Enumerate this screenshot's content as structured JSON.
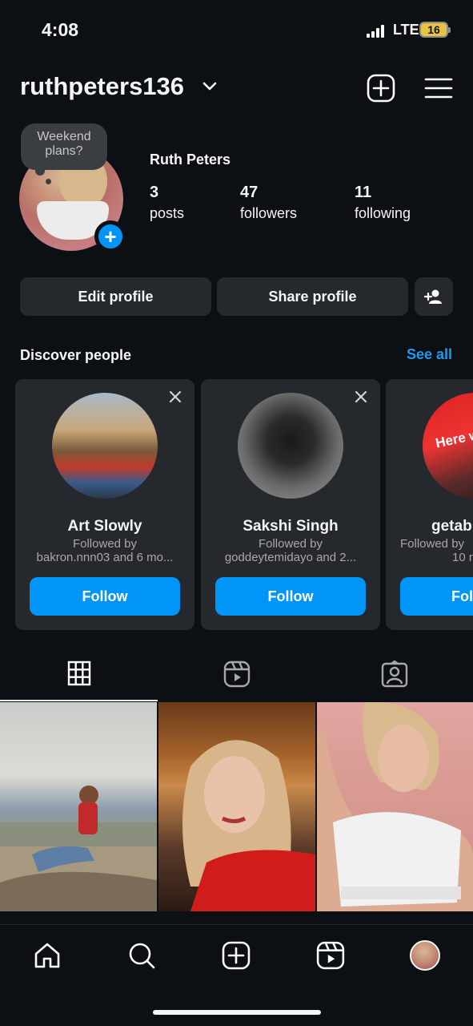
{
  "status_bar": {
    "time": "4:08",
    "network": "LTE",
    "battery": "16"
  },
  "header": {
    "username": "ruthpeters136"
  },
  "profile": {
    "note": "Weekend plans?",
    "display_name": "Ruth Peters",
    "stats": [
      {
        "count": "3",
        "label": "posts"
      },
      {
        "count": "47",
        "label": "followers"
      },
      {
        "count": "11",
        "label": "following"
      }
    ]
  },
  "actions": {
    "edit_profile": "Edit profile",
    "share_profile": "Share profile"
  },
  "discover": {
    "title": "Discover people",
    "see_all": "See all",
    "cards": [
      {
        "name": "Art Slowly",
        "line1": "Followed by",
        "line2": "bakron.nnn03 and 6 mo...",
        "follow": "Follow"
      },
      {
        "name": "Sakshi Singh",
        "line1": "Followed by",
        "line2": "goddeytemidayo and 2...",
        "follow": "Follow"
      },
      {
        "name": "getab",
        "line1": "Followed by",
        "line2": "10 n",
        "follow": "Fol"
      }
    ],
    "third_card_badge": "Here w"
  },
  "tabs": [
    {
      "icon": "grid-icon",
      "active": true
    },
    {
      "icon": "reels-icon",
      "active": false
    },
    {
      "icon": "tagged-icon",
      "active": false
    }
  ],
  "post_images": [
    "rock-sitting-photo",
    "blonde-red-photo",
    "white-top-photo"
  ],
  "bottom_nav": [
    "home-icon",
    "search-icon",
    "create-icon",
    "reels-icon",
    "profile-avatar"
  ],
  "colors": {
    "background": "#0c1014",
    "button": "#25292e",
    "accent": "#0095f6",
    "link": "#1b9bf0"
  }
}
